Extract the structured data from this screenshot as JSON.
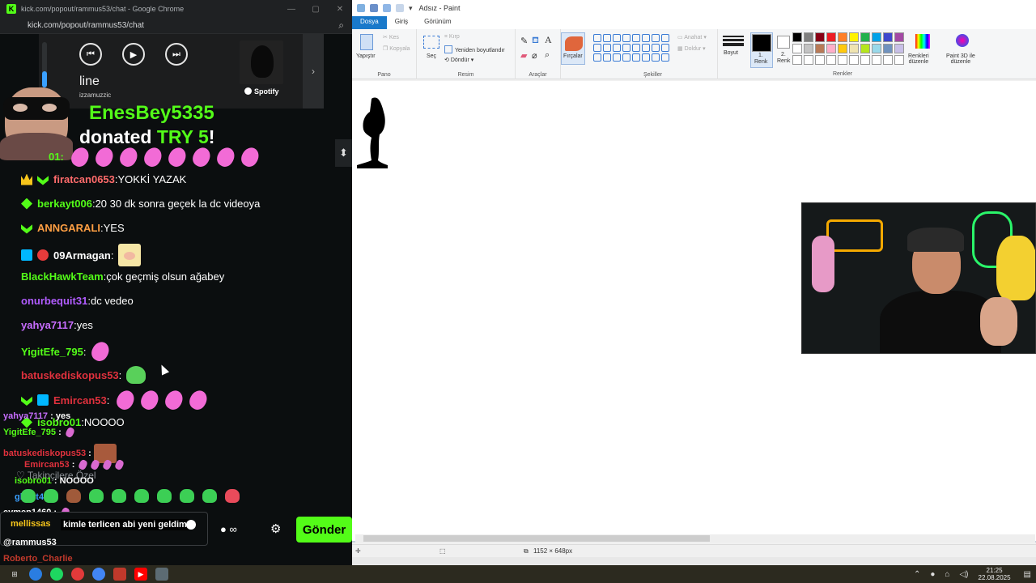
{
  "chrome": {
    "title": "kick.com/popout/rammus53/chat - Google Chrome",
    "url": "kick.com/popout/rammus53/chat",
    "zoom_icon": "zoom-icon"
  },
  "spotify": {
    "line": "line",
    "artist": "izzamuzzic",
    "brand": "Spotify",
    "progress": 0.35,
    "accent": "#3aa0ff"
  },
  "donation": {
    "name": "EnesBey5335",
    "prefix": "donated",
    "amount": "TRY 5",
    "suffix": "!"
  },
  "chat": {
    "partial_user": "01:",
    "messages": [
      {
        "user": "firatcan0653",
        "sep": ":",
        "text": " YOKKİ YAZAK",
        "color": "#ff6b6b",
        "badges": [
          "crown",
          "chevron"
        ]
      },
      {
        "user": "berkayt006",
        "sep": ":",
        "text": " 20 30 dk sonra geçek la dc videoya",
        "color": "#53fc18",
        "badges": [
          "diamond"
        ]
      },
      {
        "user": "ANNGARALI",
        "sep": ":",
        "text": " YES",
        "color": "#ff9f43",
        "badges": [
          "chevron"
        ]
      },
      {
        "user": "09Armagan",
        "sep": ":",
        "text": "",
        "color": "#ffffff",
        "badges": [
          "og",
          "red"
        ]
      },
      {
        "user": "BlackHawkTeam",
        "sep": ":",
        "text": " çok geçmiş olsun ağabey",
        "color": "#53fc18",
        "badges": []
      },
      {
        "user": "onurbequit31",
        "sep": ":",
        "text": " dc vedeo",
        "color": "#b15cff",
        "badges": []
      },
      {
        "user": "yahya7117",
        "sep": ":",
        "text": " yes",
        "color": "#c86dff",
        "badges": []
      },
      {
        "user": "YigitEfe_795",
        "sep": ":",
        "text": "",
        "color": "#53fc18",
        "badges": []
      },
      {
        "user": "batuskediskopus53",
        "sep": ":",
        "text": "",
        "color": "#e0313d",
        "badges": []
      },
      {
        "user": "Emircan53",
        "sep": ":",
        "text": "",
        "color": "#e0313d",
        "badges": [
          "chevron",
          "og"
        ]
      },
      {
        "user": "isobro01",
        "sep": ":",
        "text": " NOOOO",
        "color": "#53fc18",
        "badges": [
          "diamond"
        ]
      }
    ],
    "overlay": [
      {
        "user": "yahya7117",
        "text": " : yes",
        "color": "#c86dff"
      },
      {
        "user": "YigitEfe_795",
        "text": " :",
        "color": "#53fc18"
      },
      {
        "user": "batuskediskopus53",
        "text": " :",
        "color": "#e0313d"
      },
      {
        "user": "Emircan53",
        "text": " :",
        "color": "#e0313d"
      },
      {
        "user": "Takipçilere Özel",
        "text": "",
        "color": "#8a8f94"
      },
      {
        "user": "isobro01",
        "text": " : NOOOO",
        "color": "#53fc18"
      },
      {
        "user": "ghost47",
        "text": " :",
        "color": "#3aa0ff"
      },
      {
        "user": "eymen1460",
        "text": " :",
        "color": "#ffffff"
      },
      {
        "user": "mellissas",
        "text": " :",
        "color": "#f7c51b"
      }
    ],
    "input_text": "kimle terlicen abi yeni geldim",
    "mention": "@rammus53",
    "bottom_user": "Roberto_Charlie",
    "send_label": "Gönder",
    "tools_label": "∞"
  },
  "paint": {
    "title": "Adsız - Paint",
    "tabs": [
      "Dosya",
      "Giriş",
      "Görünüm"
    ],
    "ribbon": {
      "paste": "Yapıştır",
      "cut": "Kes",
      "copy": "Kopyala",
      "select": "Seç",
      "crop": "Kırp",
      "resize": "Yeniden boyutlandır",
      "rotate": "Döndür",
      "brushes": "Fırçalar",
      "outline": "Anahat",
      "fill": "Doldur",
      "size": "Boyut",
      "color1_l1": "1.",
      "color1_l2": "Renk",
      "color2_l1": "2.",
      "color2_l2": "Renk",
      "edit_colors_l1": "Renkleri",
      "edit_colors_l2": "düzenle",
      "paint3d_l1": "Paint 3D ile",
      "paint3d_l2": "düzenle",
      "groups": {
        "clipboard": "Pano",
        "image": "Resim",
        "tools": "Araçlar",
        "shapes": "Şekiller",
        "colors": "Renkler"
      }
    },
    "palette": [
      "#000000",
      "#7f7f7f",
      "#880015",
      "#ed1c24",
      "#ff7f27",
      "#fff200",
      "#22b14c",
      "#00a2e8",
      "#3f48cc",
      "#a349a4",
      "#ffffff",
      "#c3c3c3",
      "#b97a57",
      "#ffaec9",
      "#ffc90e",
      "#efe4b0",
      "#b5e61d",
      "#99d9ea",
      "#7092be",
      "#c8bfe7",
      "#ffffff",
      "#ffffff",
      "#ffffff",
      "#ffffff",
      "#ffffff",
      "#ffffff",
      "#ffffff",
      "#ffffff",
      "#ffffff",
      "#ffffff"
    ],
    "status_size": "1152 × 648px"
  },
  "taskbar": {
    "time": "21:25",
    "date": "22.08.2025"
  }
}
